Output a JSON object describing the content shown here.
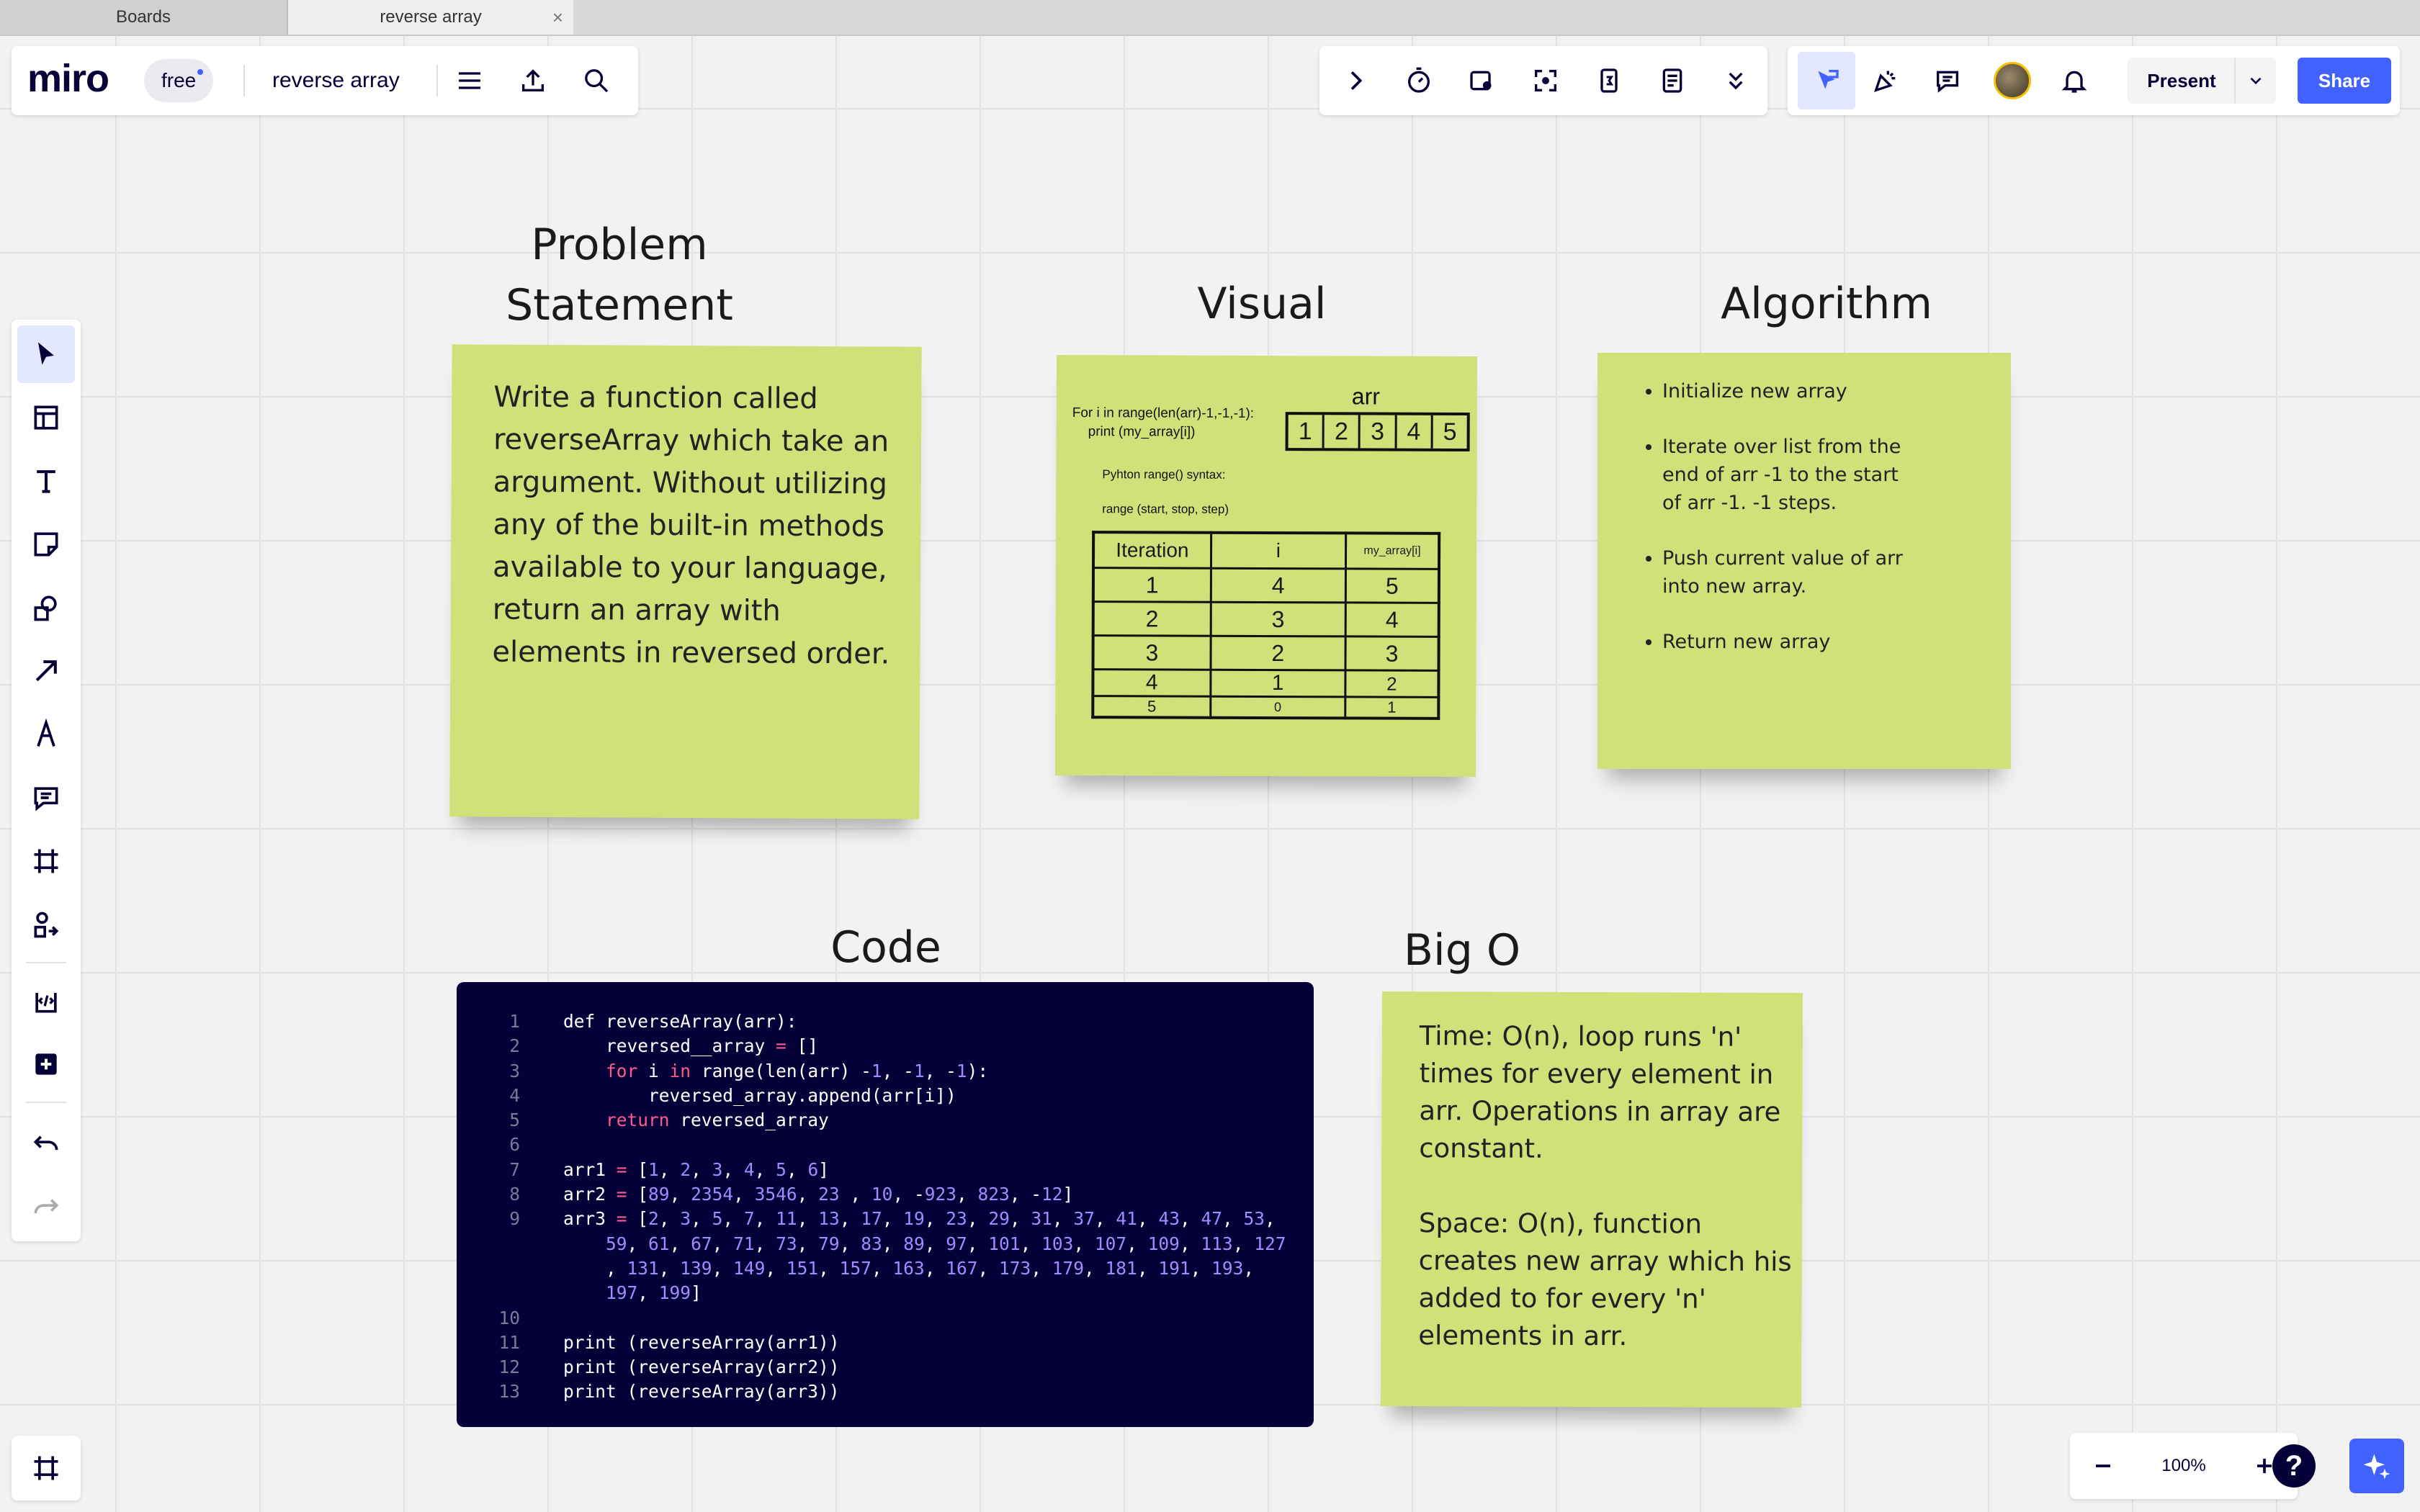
{
  "browser": {
    "tabs": [
      {
        "label": "Boards"
      },
      {
        "label": "reverse array"
      }
    ],
    "close_glyph": "×"
  },
  "app": {
    "logo": "miro",
    "plan_badge": "free",
    "board_title": "reverse array",
    "accent_color": "#4262ff",
    "brand_dark": "#050038"
  },
  "toolbar_right": {
    "present_label": "Present",
    "share_label": "Share"
  },
  "zoom": {
    "minus": "−",
    "level": "100%",
    "plus": "+",
    "help": "?"
  },
  "canvas": {
    "problem": {
      "heading_line1": "Problem",
      "heading_line2": "Statement",
      "text": "Write a function called reverseArray which take an argument. Without utilizing any of the built-in methods available to your language, return an array with elements in reversed order."
    },
    "visual": {
      "heading": "Visual",
      "for_line1": "For i in range(len(arr)-1,-1,-1):",
      "for_line2": "print (my_array[i])",
      "arr_label": "arr",
      "arr_values": [
        "1",
        "2",
        "3",
        "4",
        "5"
      ],
      "syntax_line1": "Pyhton range() syntax:",
      "syntax_line2": "range (start, stop, step)",
      "table_headers": [
        "Iteration",
        "i",
        "my_array[i]"
      ],
      "table_rows": [
        [
          "1",
          "4",
          "5"
        ],
        [
          "2",
          "3",
          "4"
        ],
        [
          "3",
          "2",
          "3"
        ],
        [
          "4",
          "1",
          "2"
        ],
        [
          "5",
          "0",
          "1"
        ]
      ]
    },
    "algorithm": {
      "heading": "Algorithm",
      "steps": [
        "Initialize new array",
        "Iterate over list from the end of arr -1 to the start of arr -1. -1 steps.",
        "Push current value of arr into new array.",
        "Return  new array"
      ]
    },
    "code": {
      "heading": "Code",
      "lines": [
        {
          "n": "1",
          "t": "def reverseArray(arr):"
        },
        {
          "n": "2",
          "t": "    reversed__array = []"
        },
        {
          "n": "3",
          "t": "    for i in range(len(arr) -1, -1, -1):"
        },
        {
          "n": "4",
          "t": "        reversed_array.append(arr[i])"
        },
        {
          "n": "5",
          "t": "    return reversed_array"
        },
        {
          "n": "6",
          "t": ""
        },
        {
          "n": "7",
          "t": "arr1 = [1, 2, 3, 4, 5, 6]"
        },
        {
          "n": "8",
          "t": "arr2 = [89, 2354, 3546, 23 , 10, -923, 823, -12]"
        },
        {
          "n": "9",
          "t": "arr3 = [2, 3, 5, 7, 11, 13, 17, 19, 23, 29, 31, 37, 41, 43, 47, 53,"
        },
        {
          "n": "",
          "t": "    59, 61, 67, 71, 73, 79, 83, 89, 97, 101, 103, 107, 109, 113, 127"
        },
        {
          "n": "",
          "t": "    , 131, 139, 149, 151, 157, 163, 167, 173, 179, 181, 191, 193,"
        },
        {
          "n": "",
          "t": "    197, 199]"
        },
        {
          "n": "10",
          "t": ""
        },
        {
          "n": "11",
          "t": "print (reverseArray(arr1))"
        },
        {
          "n": "12",
          "t": "print (reverseArray(arr2))"
        },
        {
          "n": "13",
          "t": "print (reverseArray(arr3))"
        }
      ]
    },
    "bigo": {
      "heading": "Big O",
      "time": "Time: O(n), loop runs 'n' times for every element in arr. Operations in array are constant.",
      "space": "Space: O(n), function creates new array which his added to for every 'n' elements in arr."
    }
  }
}
